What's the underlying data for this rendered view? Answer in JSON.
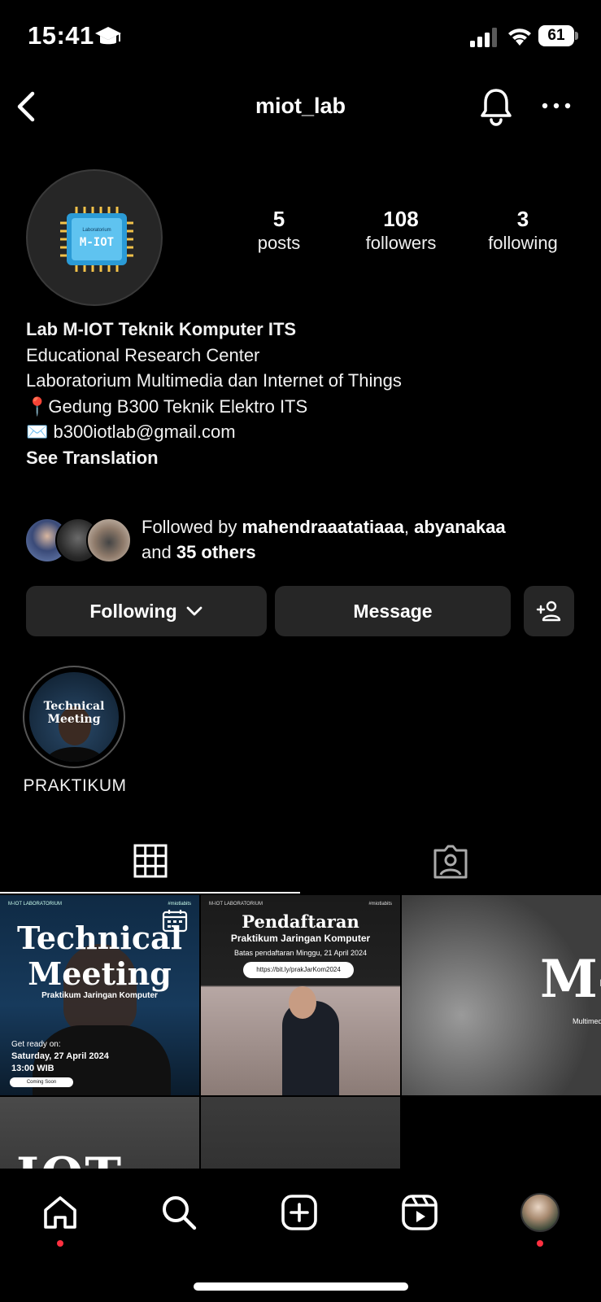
{
  "status_bar": {
    "time": "15:41",
    "battery": "61"
  },
  "header": {
    "username": "miot_lab"
  },
  "profile": {
    "stats": [
      {
        "value": "5",
        "label": "posts"
      },
      {
        "value": "108",
        "label": "followers"
      },
      {
        "value": "3",
        "label": "following"
      }
    ],
    "avatar_text": {
      "top": "Laboratorium",
      "main": "M-IOT"
    },
    "bio": {
      "name": "Lab M-IOT Teknik Komputer ITS",
      "category": "Educational Research Center",
      "line1": "Laboratorium Multimedia dan Internet of Things",
      "line2": "📍Gedung B300 Teknik Elektro ITS",
      "line3": "✉️ b300iotlab@gmail.com",
      "translate": "See Translation"
    },
    "followed_by": {
      "prefix": "Followed by ",
      "user1": "mahendraaatatiaaa",
      "sep": ", ",
      "user2": "abyanakaa",
      "and": "and ",
      "others": "35 others"
    }
  },
  "actions": {
    "following": "Following",
    "message": "Message"
  },
  "highlights": [
    {
      "label": "PRAKTIKUM"
    }
  ],
  "posts": {
    "p1": {
      "brand": "M-IOT LABORATORIUM",
      "tag": "#miotlabits",
      "title1": "Technical",
      "title2": "Meeting",
      "subtitle": "Praktikum Jaringan Komputer",
      "date_intro": "Get ready on:",
      "date": "Saturday, 27 April 2024",
      "time": "13:00 WIB",
      "pill": "Coming Soon"
    },
    "p2": {
      "brand": "M-IOT LABORATORIUM",
      "tag": "#miotlabits",
      "title": "Pendaftaran",
      "subtitle": "Praktikum Jaringan Komputer",
      "deadline": "Batas pendaftaran Minggu, 21 April 2024",
      "link": "https://bit.ly/prakJarKom2024"
    },
    "p3": {
      "title": "M-",
      "subtitle": "Multimed"
    },
    "p4": {
      "title": "IOT LAB"
    }
  },
  "colors": {
    "background": "#000000",
    "button_bg": "#262626",
    "notification": "#ff3040"
  }
}
